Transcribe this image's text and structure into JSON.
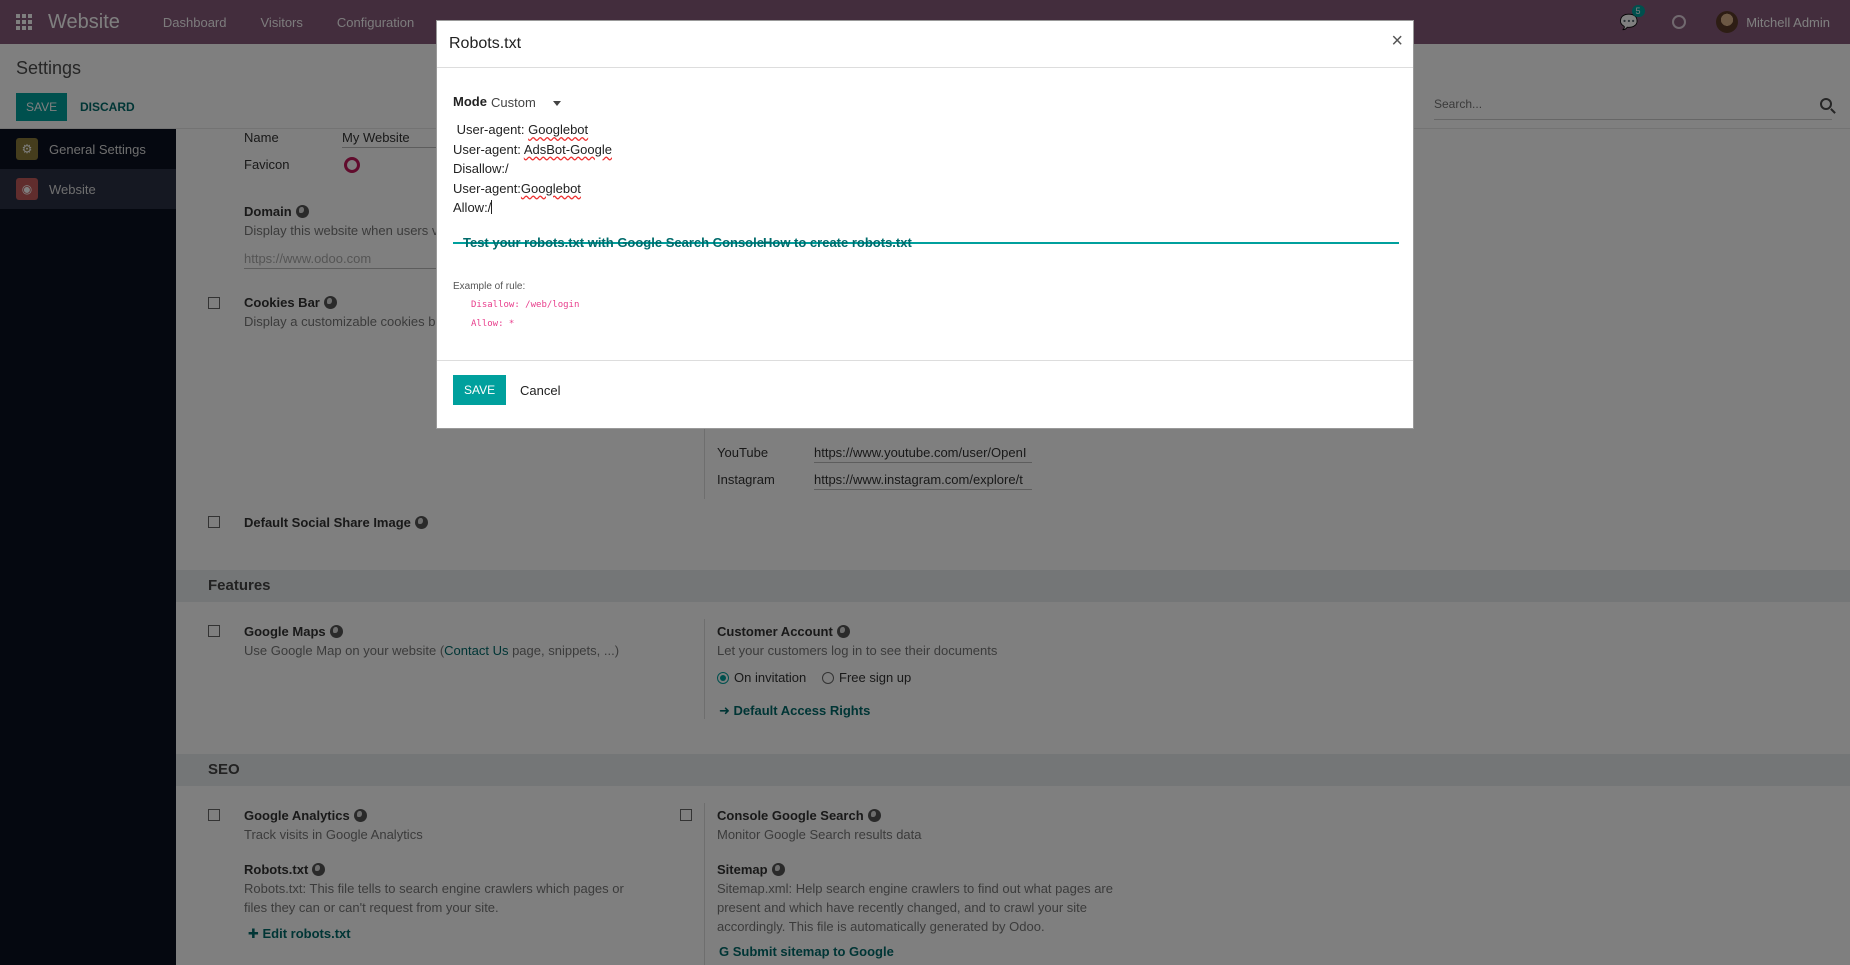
{
  "navbar": {
    "app_name": "Website",
    "menus": [
      "Dashboard",
      "Visitors",
      "Configuration"
    ],
    "chat_count": "5",
    "user": "Mitchell Admin"
  },
  "control_panel": {
    "breadcrumb": "Settings",
    "save": "SAVE",
    "discard": "DISCARD",
    "search_placeholder": "Search..."
  },
  "sidebar": {
    "items": [
      {
        "label": "General Settings",
        "icon": "gear-icon",
        "color": "#8a7b3a"
      },
      {
        "label": "Website",
        "icon": "globe-icon",
        "color": "#c05a5a"
      }
    ]
  },
  "settings": {
    "name_label": "Name",
    "name_value": "My Website",
    "favicon_label": "Favicon",
    "domain_title": "Domain",
    "domain_desc": "Display this website when users v",
    "domain_placeholder": "https://www.odoo.com",
    "cookies_title": "Cookies Bar",
    "cookies_desc": "Display a customizable cookies b",
    "youtube_label": "YouTube",
    "youtube_value": "https://www.youtube.com/user/OpenI",
    "instagram_label": "Instagram",
    "instagram_value": "https://www.instagram.com/explore/t",
    "social_image_title": "Default Social Share Image",
    "features_header": "Features",
    "gmaps_title": "Google Maps",
    "gmaps_desc_pre": "Use Google Map on your website (",
    "gmaps_desc_link": "Contact Us",
    "gmaps_desc_post": " page, snippets, ...)",
    "customer_title": "Customer Account",
    "customer_desc": "Let your customers log in to see their documents",
    "radio_invitation": "On invitation",
    "radio_signup": "Free sign up",
    "access_rights": "Default Access Rights",
    "seo_header": "SEO",
    "ga_title": "Google Analytics",
    "ga_desc": "Track visits in Google Analytics",
    "console_title": "Console Google Search",
    "console_desc": "Monitor Google Search results data",
    "robots_title": "Robots.txt",
    "robots_desc_1": "Robots.txt: This file tells to search engine crawlers which pages or",
    "robots_desc_2": "files they can or can't request from your site.",
    "edit_robots": "Edit robots.txt",
    "sitemap_title": "Sitemap",
    "sitemap_desc_1": "Sitemap.xml: Help search engine crawlers to find out what pages are",
    "sitemap_desc_2": "present and which have recently changed, and to crawl your site",
    "sitemap_desc_3": "accordingly. This file is automatically generated by Odoo.",
    "submit_sitemap": "Submit sitemap to Google"
  },
  "modal": {
    "title": "Robots.txt",
    "close": "×",
    "mode_label": "Mode",
    "mode_value": "Custom",
    "lines": {
      "l1_pre": " User-agent: ",
      "l1_word": "Googlebot",
      "l2_pre": "User-agent: ",
      "l2_word": "AdsBot-Google",
      "l3": "Disallow:/",
      "l4_pre": "User-agent:",
      "l4_word": "Googlebot",
      "l5": "Allow:/"
    },
    "link_test": "Test your robots.txt with Google Search Console",
    "link_howto": "How to create robots.txt",
    "example_label": "Example of rule:",
    "code_1": "Disallow: /web/login",
    "code_2": "Allow: *",
    "save": "SAVE",
    "cancel": "Cancel"
  },
  "colors": {
    "brand": "#875a7b",
    "accent": "#00a09d",
    "sidebar": "#0b1020"
  }
}
